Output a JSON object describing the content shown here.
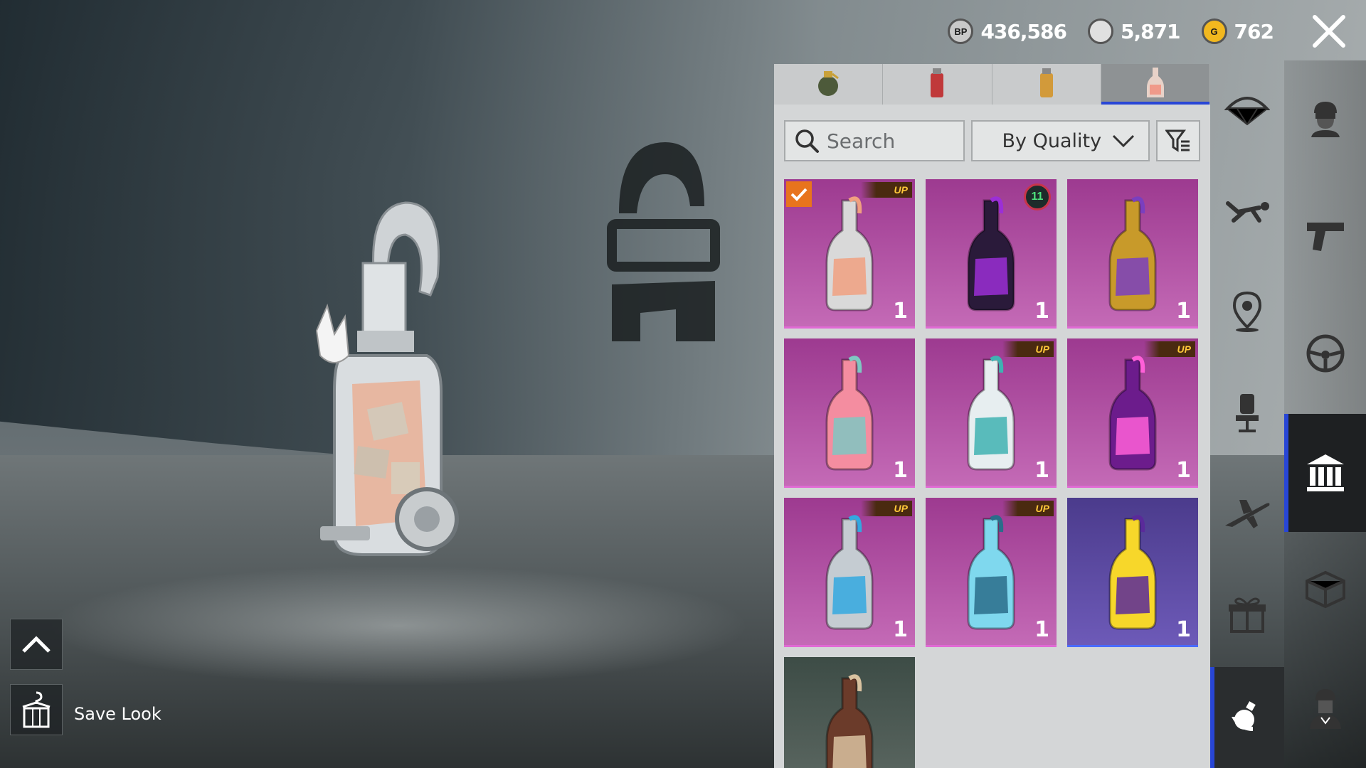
{
  "currencies": [
    {
      "name": "bp",
      "icon": "bp-coin-icon",
      "icon_text": "BP",
      "value": "436,586",
      "color": "#c9c9c9"
    },
    {
      "name": "silver",
      "icon": "silver-fragment-icon",
      "icon_text": "",
      "value": "5,871",
      "color": "#e0e0e0"
    },
    {
      "name": "gold",
      "icon": "g-coin-icon",
      "icon_text": "G",
      "value": "762",
      "color": "#f2b81f"
    }
  ],
  "tabs": [
    {
      "name": "tab-frag-grenade",
      "icon": "frag-grenade-icon",
      "active": false
    },
    {
      "name": "tab-smoke-grenade",
      "icon": "smoke-grenade-icon",
      "active": false
    },
    {
      "name": "tab-stun-grenade",
      "icon": "stun-grenade-icon",
      "active": false
    },
    {
      "name": "tab-molotov",
      "icon": "molotov-icon",
      "active": true
    }
  ],
  "search": {
    "placeholder": "Search"
  },
  "sort": {
    "label": "By Quality"
  },
  "items": [
    {
      "name": "molotov-rabbit",
      "quality": "legendary",
      "badge": "upgrade",
      "badge_text": "UP",
      "equipped": true,
      "quantity": "1",
      "colors": [
        "#d9d9d9",
        "#f0a080"
      ]
    },
    {
      "name": "molotov-demon",
      "quality": "legendary",
      "badge": "level",
      "badge_text": "11",
      "equipped": false,
      "quantity": "1",
      "colors": [
        "#2a1a3a",
        "#9b2fd6"
      ]
    },
    {
      "name": "molotov-golden",
      "quality": "legendary",
      "badge": "",
      "badge_text": "",
      "equipped": false,
      "quantity": "1",
      "colors": [
        "#c89a2a",
        "#7a3fbf"
      ]
    },
    {
      "name": "molotov-pink",
      "quality": "legendary",
      "badge": "",
      "badge_text": "",
      "equipped": false,
      "quantity": "1",
      "colors": [
        "#f48da0",
        "#7fc7c2"
      ]
    },
    {
      "name": "molotov-porcelain",
      "quality": "legendary",
      "badge": "upgrade",
      "badge_text": "UP",
      "equipped": false,
      "quantity": "1",
      "colors": [
        "#e7eef0",
        "#3fb2b2"
      ]
    },
    {
      "name": "molotov-lips",
      "quality": "legendary",
      "badge": "upgrade",
      "badge_text": "UP",
      "equipped": false,
      "quantity": "1",
      "colors": [
        "#6c1c8c",
        "#ff5fd8"
      ]
    },
    {
      "name": "molotov-frost-armor",
      "quality": "legendary",
      "badge": "upgrade",
      "badge_text": "UP",
      "equipped": false,
      "quantity": "1",
      "colors": [
        "#c5ccd2",
        "#33a8e0"
      ]
    },
    {
      "name": "molotov-ice",
      "quality": "legendary",
      "badge": "upgrade",
      "badge_text": "UP",
      "equipped": false,
      "quantity": "1",
      "colors": [
        "#7fd8ee",
        "#2a6d8a"
      ]
    },
    {
      "name": "molotov-yellow-face",
      "quality": "epic",
      "badge": "",
      "badge_text": "",
      "equipped": false,
      "quantity": "1",
      "colors": [
        "#f7d72a",
        "#5a2a9a"
      ]
    },
    {
      "name": "molotov-classic",
      "quality": "classic",
      "badge": "",
      "badge_text": "",
      "equipped": false,
      "quantity": "",
      "colors": [
        "#6b3b2a",
        "#d9c2a0"
      ]
    }
  ],
  "rail_categories": [
    {
      "name": "parachute",
      "icon": "parachute-icon",
      "active": false
    },
    {
      "name": "emote-skydive",
      "icon": "skydive-icon",
      "active": false
    },
    {
      "name": "spawn-location",
      "icon": "map-pin-icon",
      "active": false
    },
    {
      "name": "seat",
      "icon": "chair-icon",
      "active": false
    },
    {
      "name": "aircraft",
      "icon": "plane-icon",
      "active": false
    },
    {
      "name": "gift",
      "icon": "gift-icon",
      "active": false
    },
    {
      "name": "throwables",
      "icon": "throwable-hand-icon",
      "active": true
    }
  ],
  "rail_main": [
    {
      "name": "outfit",
      "icon": "soldier-head-icon",
      "active": false
    },
    {
      "name": "weapons",
      "icon": "pistol-icon",
      "active": false
    },
    {
      "name": "vehicles",
      "icon": "steering-wheel-icon",
      "active": false
    },
    {
      "name": "lobby",
      "icon": "building-icon",
      "active": true
    },
    {
      "name": "crate",
      "icon": "crate-icon",
      "active": false
    },
    {
      "name": "companion",
      "icon": "character-icon",
      "active": false
    }
  ],
  "save_look": {
    "label": "Save Look"
  }
}
